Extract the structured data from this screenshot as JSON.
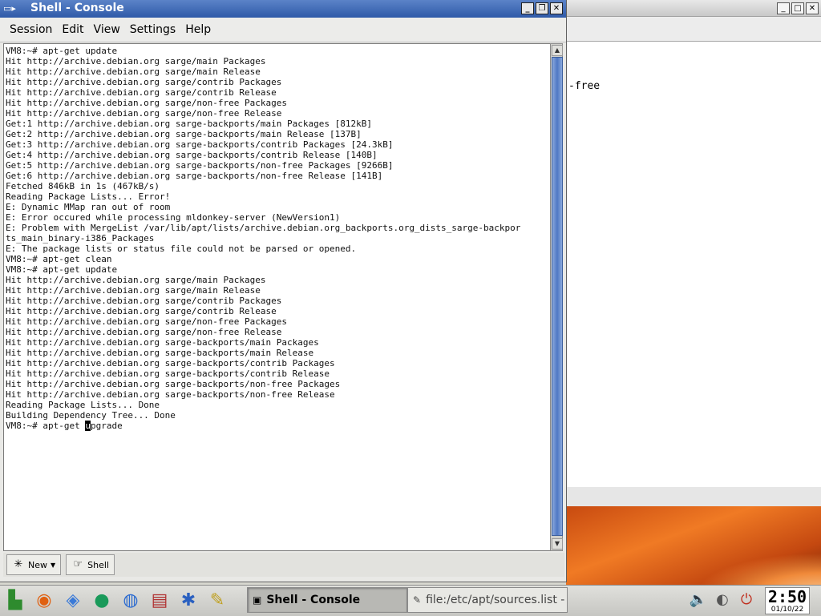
{
  "console": {
    "title": "Shell - Console",
    "menu": [
      "Session",
      "Edit",
      "View",
      "Settings",
      "Help"
    ],
    "lines_before_cursor": [
      "VM8:~# apt-get update",
      "Hit http://archive.debian.org sarge/main Packages",
      "Hit http://archive.debian.org sarge/main Release",
      "Hit http://archive.debian.org sarge/contrib Packages",
      "Hit http://archive.debian.org sarge/contrib Release",
      "Hit http://archive.debian.org sarge/non-free Packages",
      "Hit http://archive.debian.org sarge/non-free Release",
      "Get:1 http://archive.debian.org sarge-backports/main Packages [812kB]",
      "Get:2 http://archive.debian.org sarge-backports/main Release [137B]",
      "Get:3 http://archive.debian.org sarge-backports/contrib Packages [24.3kB]",
      "Get:4 http://archive.debian.org sarge-backports/contrib Release [140B]",
      "Get:5 http://archive.debian.org sarge-backports/non-free Packages [9266B]",
      "Get:6 http://archive.debian.org sarge-backports/non-free Release [141B]",
      "Fetched 846kB in 1s (467kB/s)",
      "Reading Package Lists... Error!",
      "E: Dynamic MMap ran out of room",
      "E: Error occured while processing mldonkey-server (NewVersion1)",
      "E: Problem with MergeList /var/lib/apt/lists/archive.debian.org_backports.org_dists_sarge-backpor",
      "ts_main_binary-i386_Packages",
      "E: The package lists or status file could not be parsed or opened.",
      "VM8:~# apt-get clean",
      "VM8:~# apt-get update",
      "Hit http://archive.debian.org sarge/main Packages",
      "Hit http://archive.debian.org sarge/main Release",
      "Hit http://archive.debian.org sarge/contrib Packages",
      "Hit http://archive.debian.org sarge/contrib Release",
      "Hit http://archive.debian.org sarge/non-free Packages",
      "Hit http://archive.debian.org sarge/non-free Release",
      "Hit http://archive.debian.org sarge-backports/main Packages",
      "Hit http://archive.debian.org sarge-backports/main Release",
      "Hit http://archive.debian.org sarge-backports/contrib Packages",
      "Hit http://archive.debian.org sarge-backports/contrib Release",
      "Hit http://archive.debian.org sarge-backports/non-free Packages",
      "Hit http://archive.debian.org sarge-backports/non-free Release",
      "Reading Package Lists... Done",
      "Building Dependency Tree... Done"
    ],
    "prompt_prefix": "VM8:~# apt-get ",
    "cursor_char": "u",
    "prompt_suffix": "pgrade",
    "sessions": [
      {
        "label": "New",
        "icon": "new-session-icon"
      },
      {
        "label": "Shell",
        "icon": "shell-icon"
      }
    ]
  },
  "background_window": {
    "visible_text": "-free"
  },
  "taskbar": {
    "launchers": [
      "kmenu-icon",
      "help-lifebuoy-icon",
      "home-cube-icon",
      "konqueror-icon",
      "globe-icon",
      "printer-icon",
      "kde-kicker-icon",
      "editor-pen-icon"
    ],
    "tasks": [
      {
        "label": "Shell - Console",
        "active": true
      },
      {
        "label": "file:/etc/apt/sources.list - T",
        "active": false
      }
    ],
    "clock": {
      "time": "2:50",
      "date": "01/10/22"
    }
  },
  "colors": {
    "titlebar_active": "#3d68b6",
    "scroll_thumb": "#4f78c4",
    "wallpaper_orange": "#f07a24"
  }
}
